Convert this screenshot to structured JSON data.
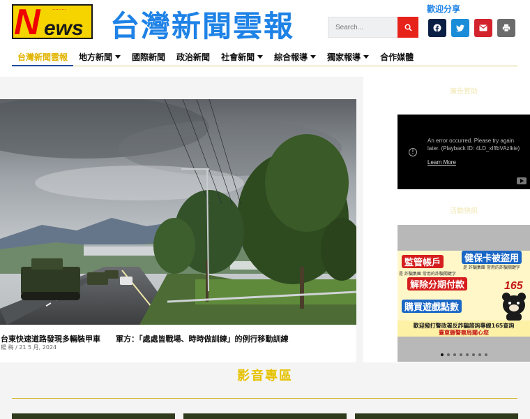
{
  "header": {
    "logo_letter": "N",
    "logo_rest": "ews",
    "logo_tagline": "·········",
    "site_title": "台灣新聞雲報",
    "search_placeholder": "Search...",
    "welcome": "歡迎分享",
    "share_icons": [
      "facebook-icon",
      "twitter-icon",
      "email-icon",
      "print-icon"
    ]
  },
  "nav": {
    "items": [
      {
        "label": "台灣新聞雲報",
        "dropdown": false,
        "active": true
      },
      {
        "label": "地方新聞",
        "dropdown": true,
        "active": false
      },
      {
        "label": "國際新聞",
        "dropdown": false,
        "active": false
      },
      {
        "label": "政治新聞",
        "dropdown": false,
        "active": false
      },
      {
        "label": "社會新聞",
        "dropdown": true,
        "active": false
      },
      {
        "label": "綜合報導",
        "dropdown": true,
        "active": false
      },
      {
        "label": "獨家報導",
        "dropdown": true,
        "active": false
      },
      {
        "label": "合作媒體",
        "dropdown": false,
        "active": false
      }
    ]
  },
  "featured": {
    "title": "台東快速道路發現多輛裝甲車　　軍方：「處處皆戰場、時時做訓練」的例行移動訓練",
    "meta": "楊 梅 / 21 5 月, 2024"
  },
  "sidebar": {
    "ad_heading": "廣告贊助",
    "video_error": "An error occurred. Please try again later. (Playback ID: 4LD_xIffbVAzlkie)",
    "video_learn_more": "Learn More",
    "activity_heading": "活動快訊",
    "promo": {
      "tag1": "監管帳戶",
      "tag2": "健保卡被盜用",
      "tag3": "解除分期付款",
      "tag4": "購買遊戲點數",
      "note1": "是 詐騙集團 常用的詐騙關鍵字",
      "note2": "是 詐騙集團 常用的詐騙關鍵字",
      "number": "165",
      "line1": "歡迎撥打警政署反詐騙諮詢專線165查詢",
      "line2": "臺東縣警察局關心您"
    },
    "carousel_dots": 8,
    "carousel_active": 0
  },
  "video_section": {
    "title": "影音專區"
  },
  "colors": {
    "brand_blue": "#1e82e6",
    "accent_yellow": "#e6c200",
    "search_red": "#e6221b"
  }
}
